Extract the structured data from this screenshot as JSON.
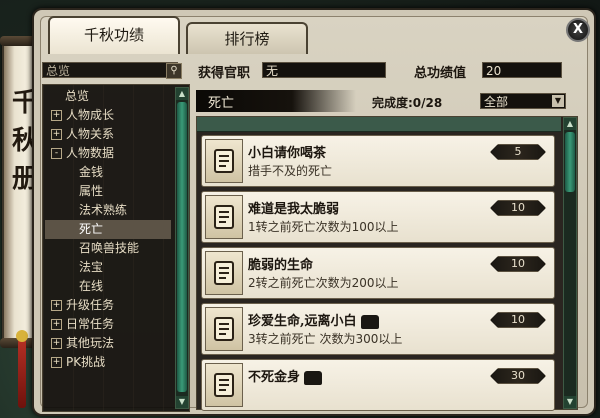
{
  "window": {
    "side_title": "千秋册",
    "close_label": "X"
  },
  "tabs": [
    {
      "label": "千秋功绩"
    },
    {
      "label": "排行榜"
    }
  ],
  "search": {
    "value": "总览"
  },
  "tree": [
    {
      "label": "总览",
      "level": "root",
      "expander": "",
      "selected": false
    },
    {
      "label": "人物成长",
      "level": "lvl0",
      "expander": "+",
      "selected": false
    },
    {
      "label": "人物关系",
      "level": "lvl0",
      "expander": "+",
      "selected": false
    },
    {
      "label": "人物数据",
      "level": "lvl0",
      "expander": "-",
      "selected": false
    },
    {
      "label": "金钱",
      "level": "lvl1",
      "expander": "",
      "selected": false
    },
    {
      "label": "属性",
      "level": "lvl1",
      "expander": "",
      "selected": false
    },
    {
      "label": "法术熟练",
      "level": "lvl1",
      "expander": "",
      "selected": false
    },
    {
      "label": "死亡",
      "level": "lvl1",
      "expander": "",
      "selected": true
    },
    {
      "label": "召唤兽技能",
      "level": "lvl1",
      "expander": "",
      "selected": false
    },
    {
      "label": "法宝",
      "level": "lvl1",
      "expander": "",
      "selected": false
    },
    {
      "label": "在线",
      "level": "lvl1",
      "expander": "",
      "selected": false
    },
    {
      "label": "升级任务",
      "level": "lvl0",
      "expander": "+",
      "selected": false
    },
    {
      "label": "日常任务",
      "level": "lvl0",
      "expander": "+",
      "selected": false
    },
    {
      "label": "其他玩法",
      "level": "lvl0",
      "expander": "+",
      "selected": false
    },
    {
      "label": "PK挑战",
      "level": "lvl0",
      "expander": "+",
      "selected": false
    }
  ],
  "header": {
    "title_label": "获得官职",
    "title_value": "无",
    "score_label": "总功绩值",
    "score_value": "20"
  },
  "category": {
    "name": "死亡",
    "progress": "完成度:0/28",
    "filter": "全部"
  },
  "achievements": [
    {
      "name": "小白请你喝茶",
      "desc": "措手不及的死亡",
      "points": "5",
      "chest": false
    },
    {
      "name": "难道是我太脆弱",
      "desc": "1转之前死亡次数为100以上",
      "points": "10",
      "chest": false
    },
    {
      "name": "脆弱的生命",
      "desc": "2转之前死亡次数为200以上",
      "points": "10",
      "chest": false
    },
    {
      "name": "珍爱生命,远离小白",
      "desc": "3转之前死亡 次数为300以上",
      "points": "10",
      "chest": true
    },
    {
      "name": "不死金身",
      "desc": "",
      "points": "30",
      "chest": true
    }
  ]
}
